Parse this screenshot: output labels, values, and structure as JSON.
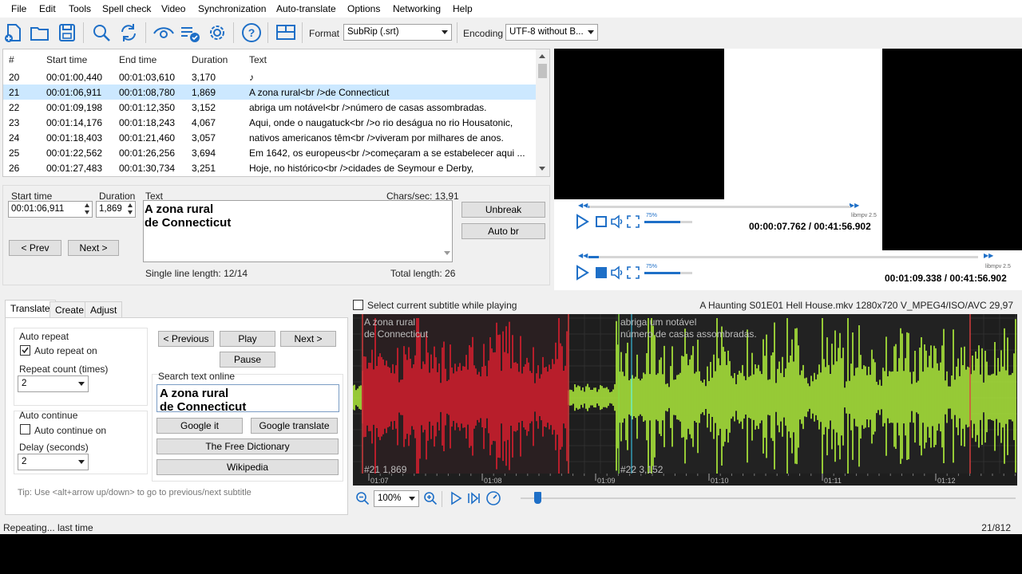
{
  "menu": [
    "File",
    "Edit",
    "Tools",
    "Spell check",
    "Video",
    "Synchronization",
    "Auto-translate",
    "Options",
    "Networking",
    "Help"
  ],
  "toolbar": {
    "format_label": "Format",
    "format_value": "SubRip (.srt)",
    "encoding_label": "Encoding",
    "encoding_value": "UTF-8 without B...",
    "icons": [
      "new-file-icon",
      "open-folder-icon",
      "save-icon",
      "search-icon",
      "replace-icon",
      "visual-sync-icon",
      "spell-check-icon",
      "settings-icon",
      "help-icon",
      "layout-icon"
    ]
  },
  "grid": {
    "headers": [
      "#",
      "Start time",
      "End time",
      "Duration",
      "Text"
    ],
    "rows": [
      {
        "n": "20",
        "start": "00:01:00,440",
        "end": "00:01:03,610",
        "dur": "3,170",
        "text": "♪"
      },
      {
        "n": "21",
        "start": "00:01:06,911",
        "end": "00:01:08,780",
        "dur": "1,869",
        "text": "A zona rural<br />de Connecticut"
      },
      {
        "n": "22",
        "start": "00:01:09,198",
        "end": "00:01:12,350",
        "dur": "3,152",
        "text": "abriga um notável<br />número de casas assombradas."
      },
      {
        "n": "23",
        "start": "00:01:14,176",
        "end": "00:01:18,243",
        "dur": "4,067",
        "text": "Aqui, onde o naugatuck<br />o rio deságua no rio Housatonic,"
      },
      {
        "n": "24",
        "start": "00:01:18,403",
        "end": "00:01:21,460",
        "dur": "3,057",
        "text": "nativos americanos têm<br />viveram por milhares de anos."
      },
      {
        "n": "25",
        "start": "00:01:22,562",
        "end": "00:01:26,256",
        "dur": "3,694",
        "text": "Em 1642, os europeus<br />começaram a se estabelecer aqui ..."
      },
      {
        "n": "26",
        "start": "00:01:27,483",
        "end": "00:01:30,734",
        "dur": "3,251",
        "text": "Hoje, no histórico<br />cidades de Seymour e Derby,"
      }
    ],
    "selected_index": 1
  },
  "edit": {
    "start_label": "Start time",
    "start_value": "00:01:06,911",
    "duration_label": "Duration",
    "duration_value": "1,869",
    "text_label": "Text",
    "chars_sec": "Chars/sec: 13,91",
    "text_line1": "A zona rural",
    "text_line2": "de Connecticut",
    "single_line": "Single line length: 12/14",
    "total_length": "Total length: 26",
    "prev": "< Prev",
    "next": "Next >",
    "unbreak": "Unbreak",
    "auto_br": "Auto br"
  },
  "video": {
    "time1": "00:00:07.762 / 00:41:56.902",
    "time2": "00:01:09.338 / 00:41:56.902",
    "volume_label": "75%",
    "engine": "libmpv 2.5",
    "volume_level": 0.75,
    "progress1": 0.003,
    "progress2": 0.027
  },
  "tabs": [
    "Translate",
    "Create",
    "Adjust"
  ],
  "translate": {
    "auto_repeat": "Auto repeat",
    "auto_repeat_on": "Auto repeat on",
    "repeat_count_label": "Repeat count (times)",
    "repeat_count": "2",
    "auto_continue": "Auto continue",
    "auto_continue_on": "Auto continue on",
    "delay_label": "Delay (seconds)",
    "delay": "2",
    "previous": "< Previous",
    "play": "Play",
    "next": "Next >",
    "pause": "Pause",
    "search_online": "Search text online",
    "search_line1": "A zona rural",
    "search_line2": "de Connecticut",
    "google_it": "Google it",
    "google_translate": "Google translate",
    "free_dictionary": "The Free Dictionary",
    "wikipedia": "Wikipedia",
    "tip": "Tip: Use <alt+arrow up/down> to go to previous/next subtitle"
  },
  "waveform": {
    "select_while_playing": "Select current subtitle while playing",
    "file_info": "A Haunting S01E01 Hell House.mkv 1280x720 V_MPEG4/ISO/AVC 29,97",
    "sub1_line1": "A zona rural",
    "sub1_line2": "de Connecticut",
    "sub2_line1": "abriga um notável",
    "sub2_line2": "número de casas assombradas.",
    "sub1_info": "#21  1,869",
    "sub2_info": "#22  3,152",
    "ticks": [
      "01:07",
      "01:08",
      "01:09",
      "01:10",
      "01:11",
      "01:12"
    ],
    "zoom": "100%",
    "colors": {
      "selected": "#dc1f2e",
      "other": "#b4f43c",
      "background": "#1e1e1e"
    }
  },
  "status": {
    "left": "Repeating... last time",
    "right": "21/812"
  }
}
